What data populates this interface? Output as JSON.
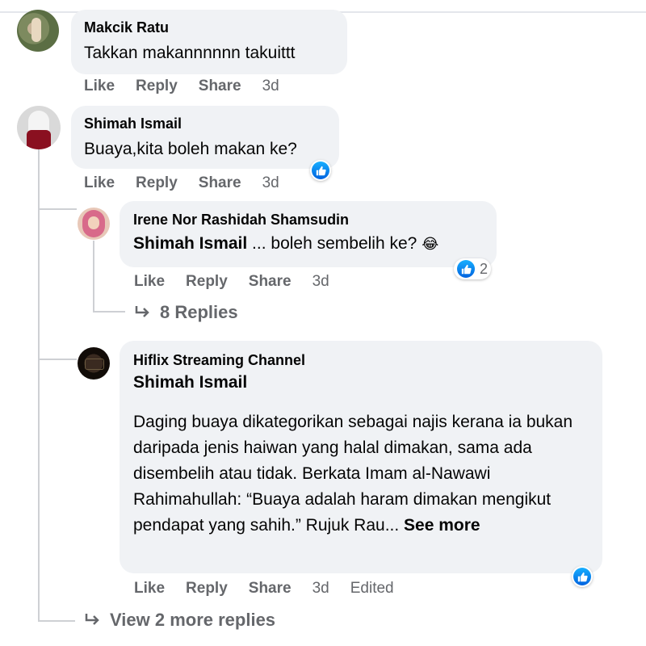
{
  "comments": [
    {
      "author": "Makcik Ratu",
      "text": "Takkan makannnnnn takuittt",
      "actions": {
        "like": "Like",
        "reply": "Reply",
        "share": "Share",
        "time": "3d"
      }
    },
    {
      "author": "Shimah Ismail",
      "text": "Buaya,kita boleh makan ke?",
      "actions": {
        "like": "Like",
        "reply": "Reply",
        "share": "Share",
        "time": "3d"
      },
      "reaction": "like-icon",
      "replies": [
        {
          "author": "Irene Nor Rashidah Shamsudin",
          "mention": "Shimah Ismail",
          "text": " ... boleh sembelih ke? ",
          "emoji": "😂",
          "reaction_count": "2",
          "actions": {
            "like": "Like",
            "reply": "Reply",
            "share": "Share",
            "time": "3d"
          },
          "more_replies": "8 Replies"
        },
        {
          "author": "Hiflix Streaming Channel",
          "mention": "Shimah Ismail",
          "text": "Daging buaya dikategorikan sebagai najis kerana ia bukan daripada jenis haiwan yang halal dimakan, sama ada disembelih atau tidak. Berkata Imam al-Nawawi Rahimahullah: “Buaya adalah haram dimakan mengikut pendapat yang sahih.” Rujuk Rau... ",
          "see_more": "See more",
          "actions": {
            "like": "Like",
            "reply": "Reply",
            "share": "Share",
            "time": "3d",
            "edited": "Edited"
          }
        }
      ],
      "view_more": "View 2 more replies"
    }
  ],
  "colors": {
    "bubble": "#f0f2f5",
    "action": "#65676b",
    "like_blue": "#1877f2",
    "thread_line": "#ced0d4"
  }
}
